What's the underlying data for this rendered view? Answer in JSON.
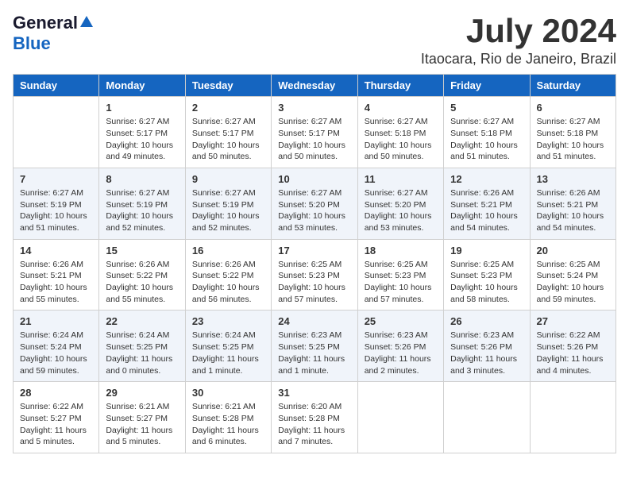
{
  "logo": {
    "general": "General",
    "blue": "Blue"
  },
  "title": "July 2024",
  "location": "Itaocara, Rio de Janeiro, Brazil",
  "weekdays": [
    "Sunday",
    "Monday",
    "Tuesday",
    "Wednesday",
    "Thursday",
    "Friday",
    "Saturday"
  ],
  "rows": [
    [
      {
        "day": "",
        "info": ""
      },
      {
        "day": "1",
        "info": "Sunrise: 6:27 AM\nSunset: 5:17 PM\nDaylight: 10 hours\nand 49 minutes."
      },
      {
        "day": "2",
        "info": "Sunrise: 6:27 AM\nSunset: 5:17 PM\nDaylight: 10 hours\nand 50 minutes."
      },
      {
        "day": "3",
        "info": "Sunrise: 6:27 AM\nSunset: 5:17 PM\nDaylight: 10 hours\nand 50 minutes."
      },
      {
        "day": "4",
        "info": "Sunrise: 6:27 AM\nSunset: 5:18 PM\nDaylight: 10 hours\nand 50 minutes."
      },
      {
        "day": "5",
        "info": "Sunrise: 6:27 AM\nSunset: 5:18 PM\nDaylight: 10 hours\nand 51 minutes."
      },
      {
        "day": "6",
        "info": "Sunrise: 6:27 AM\nSunset: 5:18 PM\nDaylight: 10 hours\nand 51 minutes."
      }
    ],
    [
      {
        "day": "7",
        "info": "Sunrise: 6:27 AM\nSunset: 5:19 PM\nDaylight: 10 hours\nand 51 minutes."
      },
      {
        "day": "8",
        "info": "Sunrise: 6:27 AM\nSunset: 5:19 PM\nDaylight: 10 hours\nand 52 minutes."
      },
      {
        "day": "9",
        "info": "Sunrise: 6:27 AM\nSunset: 5:19 PM\nDaylight: 10 hours\nand 52 minutes."
      },
      {
        "day": "10",
        "info": "Sunrise: 6:27 AM\nSunset: 5:20 PM\nDaylight: 10 hours\nand 53 minutes."
      },
      {
        "day": "11",
        "info": "Sunrise: 6:27 AM\nSunset: 5:20 PM\nDaylight: 10 hours\nand 53 minutes."
      },
      {
        "day": "12",
        "info": "Sunrise: 6:26 AM\nSunset: 5:21 PM\nDaylight: 10 hours\nand 54 minutes."
      },
      {
        "day": "13",
        "info": "Sunrise: 6:26 AM\nSunset: 5:21 PM\nDaylight: 10 hours\nand 54 minutes."
      }
    ],
    [
      {
        "day": "14",
        "info": "Sunrise: 6:26 AM\nSunset: 5:21 PM\nDaylight: 10 hours\nand 55 minutes."
      },
      {
        "day": "15",
        "info": "Sunrise: 6:26 AM\nSunset: 5:22 PM\nDaylight: 10 hours\nand 55 minutes."
      },
      {
        "day": "16",
        "info": "Sunrise: 6:26 AM\nSunset: 5:22 PM\nDaylight: 10 hours\nand 56 minutes."
      },
      {
        "day": "17",
        "info": "Sunrise: 6:25 AM\nSunset: 5:23 PM\nDaylight: 10 hours\nand 57 minutes."
      },
      {
        "day": "18",
        "info": "Sunrise: 6:25 AM\nSunset: 5:23 PM\nDaylight: 10 hours\nand 57 minutes."
      },
      {
        "day": "19",
        "info": "Sunrise: 6:25 AM\nSunset: 5:23 PM\nDaylight: 10 hours\nand 58 minutes."
      },
      {
        "day": "20",
        "info": "Sunrise: 6:25 AM\nSunset: 5:24 PM\nDaylight: 10 hours\nand 59 minutes."
      }
    ],
    [
      {
        "day": "21",
        "info": "Sunrise: 6:24 AM\nSunset: 5:24 PM\nDaylight: 10 hours\nand 59 minutes."
      },
      {
        "day": "22",
        "info": "Sunrise: 6:24 AM\nSunset: 5:25 PM\nDaylight: 11 hours\nand 0 minutes."
      },
      {
        "day": "23",
        "info": "Sunrise: 6:24 AM\nSunset: 5:25 PM\nDaylight: 11 hours\nand 1 minute."
      },
      {
        "day": "24",
        "info": "Sunrise: 6:23 AM\nSunset: 5:25 PM\nDaylight: 11 hours\nand 1 minute."
      },
      {
        "day": "25",
        "info": "Sunrise: 6:23 AM\nSunset: 5:26 PM\nDaylight: 11 hours\nand 2 minutes."
      },
      {
        "day": "26",
        "info": "Sunrise: 6:23 AM\nSunset: 5:26 PM\nDaylight: 11 hours\nand 3 minutes."
      },
      {
        "day": "27",
        "info": "Sunrise: 6:22 AM\nSunset: 5:26 PM\nDaylight: 11 hours\nand 4 minutes."
      }
    ],
    [
      {
        "day": "28",
        "info": "Sunrise: 6:22 AM\nSunset: 5:27 PM\nDaylight: 11 hours\nand 5 minutes."
      },
      {
        "day": "29",
        "info": "Sunrise: 6:21 AM\nSunset: 5:27 PM\nDaylight: 11 hours\nand 5 minutes."
      },
      {
        "day": "30",
        "info": "Sunrise: 6:21 AM\nSunset: 5:28 PM\nDaylight: 11 hours\nand 6 minutes."
      },
      {
        "day": "31",
        "info": "Sunrise: 6:20 AM\nSunset: 5:28 PM\nDaylight: 11 hours\nand 7 minutes."
      },
      {
        "day": "",
        "info": ""
      },
      {
        "day": "",
        "info": ""
      },
      {
        "day": "",
        "info": ""
      }
    ]
  ]
}
